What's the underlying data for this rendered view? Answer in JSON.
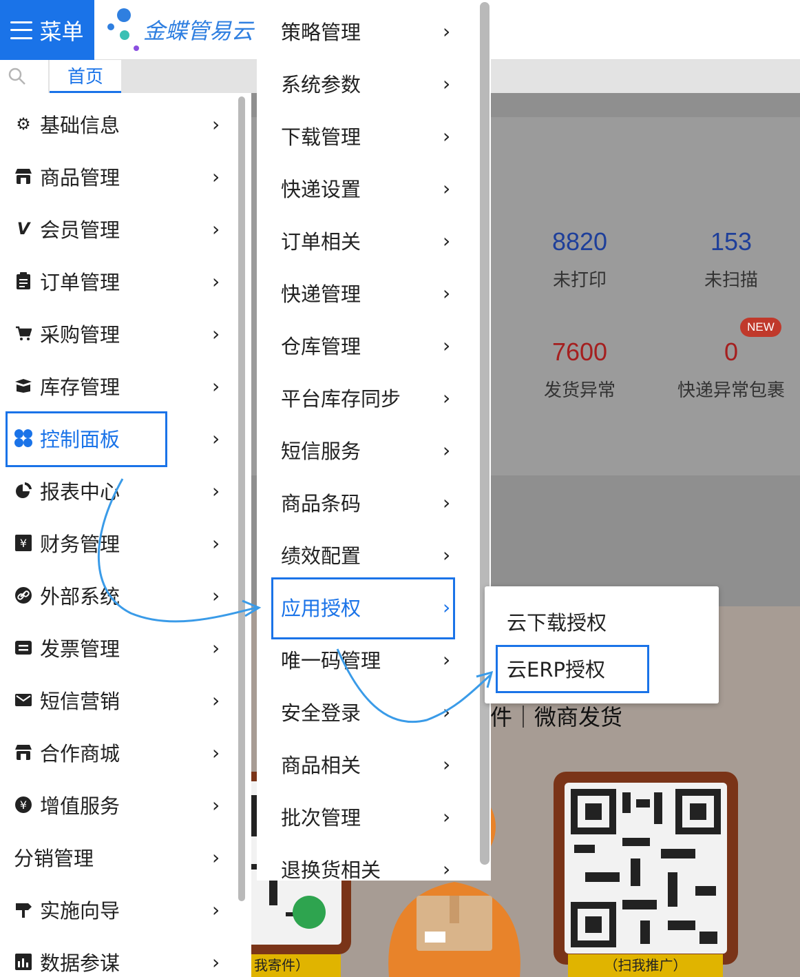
{
  "header": {
    "menu_label": "菜单",
    "logo_text": "金蝶管易云",
    "home_tab": "首页"
  },
  "colors": {
    "accent": "#1a73e8",
    "stat_blue": "#1e3f9a",
    "stat_red": "#a51f1f",
    "badge": "#c0392b"
  },
  "dashboard": {
    "stats": [
      {
        "value": "8820",
        "label": "未打印"
      },
      {
        "value": "153",
        "label": "未扫描"
      },
      {
        "value": "7600",
        "label": "发货异常"
      },
      {
        "value": "0",
        "label": "快递异常包裹"
      }
    ],
    "new_badge": "NEW",
    "promo_text": "件｜微商发货",
    "qr_caption_left": "我寄件）",
    "qr_caption_right": "（扫我推广）"
  },
  "menu1": {
    "items": [
      {
        "label": "基础信息",
        "icon": "gear-icon"
      },
      {
        "label": "商品管理",
        "icon": "store-icon"
      },
      {
        "label": "会员管理",
        "icon": "v-icon"
      },
      {
        "label": "订单管理",
        "icon": "clipboard-icon"
      },
      {
        "label": "采购管理",
        "icon": "cart-icon"
      },
      {
        "label": "库存管理",
        "icon": "box-icon"
      },
      {
        "label": "控制面板",
        "icon": "dashboard-icon"
      },
      {
        "label": "报表中心",
        "icon": "pie-chart-icon"
      },
      {
        "label": "财务管理",
        "icon": "yen-box-icon"
      },
      {
        "label": "外部系统",
        "icon": "link-icon"
      },
      {
        "label": "发票管理",
        "icon": "invoice-icon"
      },
      {
        "label": "短信营销",
        "icon": "mail-icon"
      },
      {
        "label": "合作商城",
        "icon": "shop-icon"
      },
      {
        "label": "增值服务",
        "icon": "yen-circle-icon"
      },
      {
        "label": "分销管理",
        "icon": ""
      },
      {
        "label": "实施向导",
        "icon": "signpost-icon"
      },
      {
        "label": "数据参谋",
        "icon": "data-icon"
      }
    ],
    "active_index": 6
  },
  "menu2": {
    "items": [
      "策略管理",
      "系统参数",
      "下载管理",
      "快递设置",
      "订单相关",
      "快递管理",
      "仓库管理",
      "平台库存同步",
      "短信服务",
      "商品条码",
      "绩效配置",
      "应用授权",
      "唯一码管理",
      "安全登录",
      "商品相关",
      "批次管理",
      "退换货相关"
    ],
    "active_index": 11
  },
  "menu3": {
    "items": [
      "云下载授权",
      "云ERP授权"
    ],
    "highlight_index": 1
  }
}
